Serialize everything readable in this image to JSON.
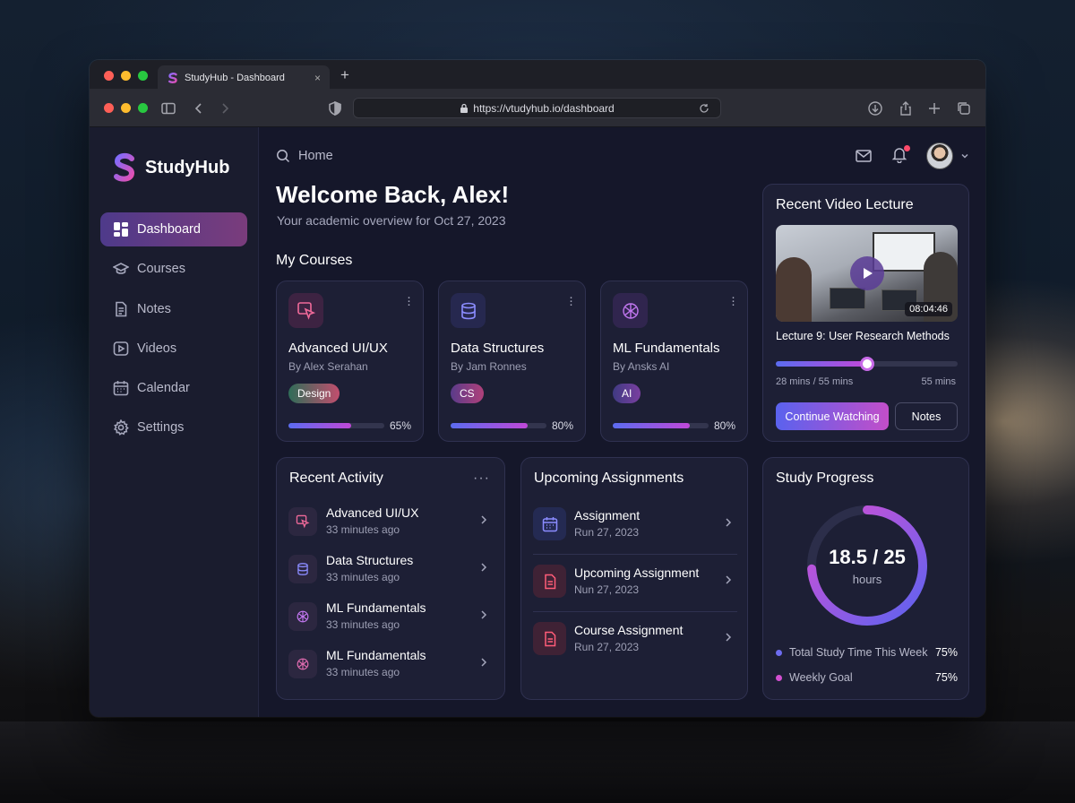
{
  "browser": {
    "tab_title": "StudyHub - Dashboard",
    "tab_close": "×",
    "new_tab": "+",
    "url": "https://vtudyhub.io/dashboard"
  },
  "sidebar": {
    "brand": "StudyHub",
    "items": [
      {
        "label": "Dashboard",
        "icon": "grid-icon",
        "active": true
      },
      {
        "label": "Courses",
        "icon": "graduation-cap-icon"
      },
      {
        "label": "Notes",
        "icon": "document-icon"
      },
      {
        "label": "Videos",
        "icon": "play-square-icon"
      },
      {
        "label": "Calendar",
        "icon": "calendar-icon"
      },
      {
        "label": "Settings",
        "icon": "gear-icon"
      }
    ]
  },
  "header": {
    "breadcrumb": "Home",
    "welcome": "Welcome Back, Alex!",
    "subtitle": "Your academic overview for Oct 27, 2023"
  },
  "courses": {
    "title": "My Courses",
    "items": [
      {
        "name": "Advanced UI/UX",
        "by": "By Alex Serahan",
        "tag": "Design",
        "progress": 0.65,
        "progress_label": "65%",
        "tag_color": "#c24e6e",
        "icon": "design-tool-icon"
      },
      {
        "name": "Data Structures",
        "by": "By Jam Ronnes",
        "tag": "CS",
        "progress": 0.8,
        "progress_label": "80%",
        "tag_color": "#b0407a",
        "icon": "database-icon"
      },
      {
        "name": "ML Fundamentals",
        "by": "By Ansks AI",
        "tag": "AI",
        "progress": 0.8,
        "progress_label": "80%",
        "tag_color": "#7a3fa0",
        "icon": "brain-icon"
      }
    ]
  },
  "video": {
    "title": "Recent Video Lecture",
    "duration": "08:04:46",
    "lecture": "Lecture 9: User Research Methods",
    "progress": 0.5,
    "watched": "28 mins / 55 mins",
    "total": "55 mins",
    "continue_label": "Continue Watching",
    "notes_label": "Notes"
  },
  "activity": {
    "title": "Recent Activity",
    "items": [
      {
        "title": "Advanced UI/UX",
        "time": "33 minutes ago",
        "icon": "design-tool-icon"
      },
      {
        "title": "Data Structures",
        "time": "33 minutes ago",
        "icon": "database-icon"
      },
      {
        "title": "ML Fundamentals",
        "time": "33 minutes ago",
        "icon": "brain-icon"
      },
      {
        "title": "ML Fundamentals",
        "time": "33 minutes ago",
        "icon": "brain-icon"
      }
    ]
  },
  "assignments": {
    "title": "Upcoming Assignments",
    "items": [
      {
        "title": "Assignment",
        "date": "Run 27, 2023",
        "icon": "calendar-icon"
      },
      {
        "title": "Upcoming Assignment",
        "date": "Nun 27, 2023",
        "icon": "file-icon"
      },
      {
        "title": "Course Assignment",
        "date": "Run 27, 2023",
        "icon": "file-icon"
      }
    ]
  },
  "study_progress": {
    "title": "Study Progress",
    "value": "18.5 / 25",
    "unit": "hours",
    "ratio": 0.74,
    "legend": [
      {
        "label": "Total Study Time This Week",
        "value": "75%",
        "color": "#6d6cf0"
      },
      {
        "label": "Weekly Goal",
        "value": "75%",
        "color": "#d24fd0"
      }
    ]
  }
}
